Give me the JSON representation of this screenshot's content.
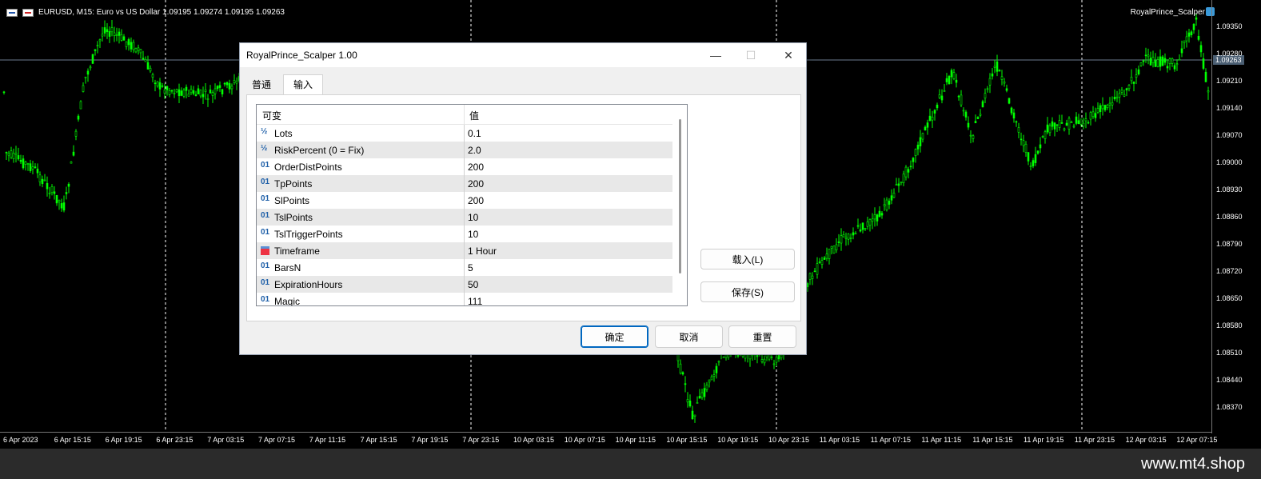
{
  "chart": {
    "symbol_info": "EURUSD, M15:  Euro vs US Dollar  1.09195 1.09274 1.09195 1.09263",
    "ea_name": "RoyalPrince_Scalper",
    "current_price": "1.09263",
    "price_labels": [
      "1.09350",
      "1.09280",
      "1.09210",
      "1.09140",
      "1.09070",
      "1.09000",
      "1.08930",
      "1.08860",
      "1.08790",
      "1.08720",
      "1.08650",
      "1.08580",
      "1.08510",
      "1.08440",
      "1.08370"
    ],
    "time_labels": [
      "6 Apr 2023",
      "6 Apr 15:15",
      "6 Apr 19:15",
      "6 Apr 23:15",
      "7 Apr 03:15",
      "7 Apr 07:15",
      "7 Apr 11:15",
      "7 Apr 15:15",
      "7 Apr 19:15",
      "7 Apr 23:15",
      "10 Apr 03:15",
      "10 Apr 07:15",
      "10 Apr 11:15",
      "10 Apr 15:15",
      "10 Apr 19:15",
      "10 Apr 23:15",
      "11 Apr 03:15",
      "11 Apr 07:15",
      "11 Apr 11:15",
      "11 Apr 15:15",
      "11 Apr 19:15",
      "11 Apr 23:15",
      "12 Apr 03:15",
      "12 Apr 07:15"
    ],
    "colors": {
      "candle": "#00ff00",
      "background": "#000000",
      "grid_line": "#ffffff"
    }
  },
  "dialog": {
    "title": "RoyalPrince_Scalper 1.00",
    "window_buttons": {
      "minimize": "—",
      "maximize": "☐",
      "close": "✕"
    },
    "tabs": [
      "普通",
      "输入"
    ],
    "active_tab": "输入",
    "grid": {
      "headers": [
        "可变",
        "值"
      ],
      "rows": [
        {
          "icon": "½",
          "name": "Lots",
          "value": "0.1"
        },
        {
          "icon": "½",
          "name": "RiskPercent (0 = Fix)",
          "value": "2.0"
        },
        {
          "icon": "01",
          "name": "OrderDistPoints",
          "value": "200"
        },
        {
          "icon": "01",
          "name": "TpPoints",
          "value": "200"
        },
        {
          "icon": "01",
          "name": "SlPoints",
          "value": "200"
        },
        {
          "icon": "01",
          "name": "TslPoints",
          "value": "10"
        },
        {
          "icon": "01",
          "name": "TslTriggerPoints",
          "value": "10"
        },
        {
          "icon": "timeframe",
          "name": "Timeframe",
          "value": "1 Hour"
        },
        {
          "icon": "01",
          "name": "BarsN",
          "value": "5"
        },
        {
          "icon": "01",
          "name": "ExpirationHours",
          "value": "50"
        },
        {
          "icon": "01",
          "name": "Magic",
          "value": "111"
        }
      ]
    },
    "side_buttons": {
      "load": "载入(L)",
      "save": "保存(S)"
    },
    "footer_buttons": {
      "ok": "确定",
      "cancel": "取消",
      "reset": "重置"
    }
  },
  "watermark": "www.mt4.shop"
}
